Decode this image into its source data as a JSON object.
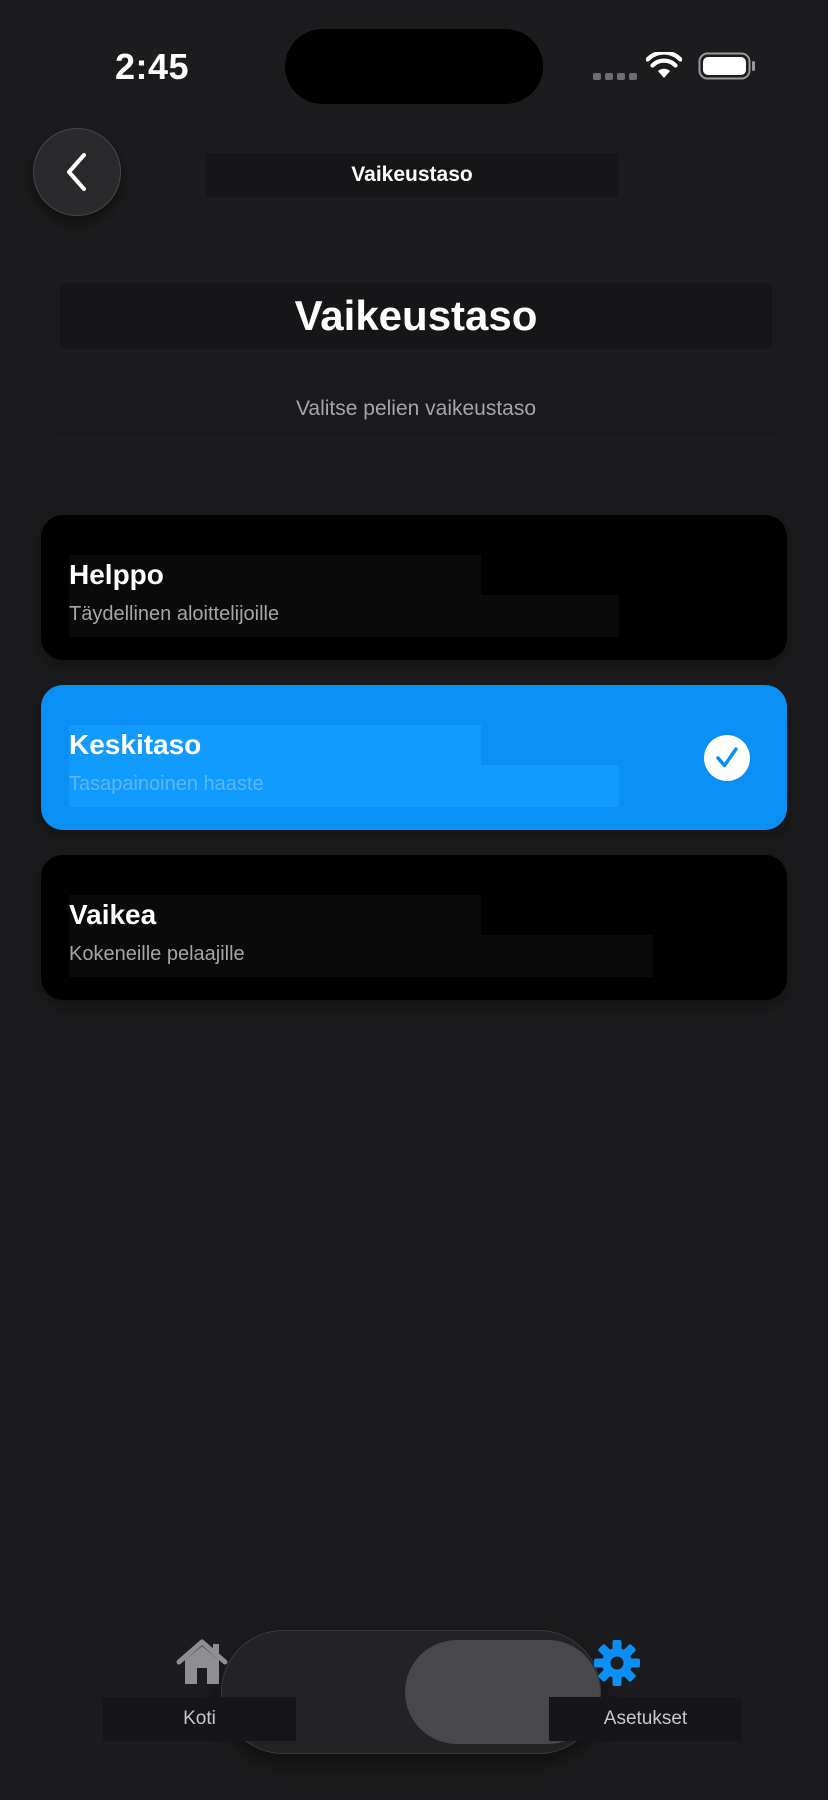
{
  "status_bar": {
    "time": "2:45"
  },
  "nav": {
    "title": "Vaikeustaso"
  },
  "header": {
    "title": "Vaikeustaso",
    "subtitle": "Valitse pelien vaikeustaso"
  },
  "difficulty_options": [
    {
      "name": "Helppo",
      "description": "Täydellinen aloittelijoille",
      "selected": false
    },
    {
      "name": "Keskitaso",
      "description": "Tasapainoinen haaste",
      "selected": true
    },
    {
      "name": "Vaikea",
      "description": "Kokeneille pelaajille",
      "selected": false
    }
  ],
  "tab_bar": {
    "items": [
      {
        "label": "Koti",
        "icon": "home-icon",
        "active": false
      },
      {
        "label": "Asetukset",
        "icon": "gear-icon",
        "active": true
      }
    ]
  },
  "colors": {
    "background": "#1c1c1e",
    "accent": "#0a8ff5",
    "card": "#000000",
    "secondary_text": "#a5a5aa"
  }
}
